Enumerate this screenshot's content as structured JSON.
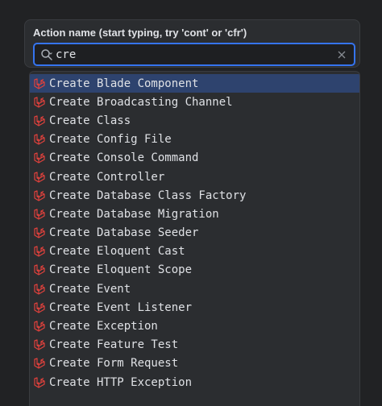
{
  "dialog": {
    "label": "Action name (start typing, try 'cont' or 'cfr')",
    "search_value": "cre"
  },
  "colors": {
    "accent": "#3574f0",
    "selection": "#2e436e",
    "laravel_icon": "#e0413c"
  },
  "icons": {
    "search": "search-icon",
    "clear": "close-icon",
    "item": "laravel-icon"
  },
  "items": [
    {
      "label": "Create Blade Component",
      "selected": true
    },
    {
      "label": "Create Broadcasting Channel"
    },
    {
      "label": "Create Class"
    },
    {
      "label": "Create Config File"
    },
    {
      "label": "Create Console Command"
    },
    {
      "label": "Create Controller"
    },
    {
      "label": "Create Database Class Factory"
    },
    {
      "label": "Create Database Migration"
    },
    {
      "label": "Create Database Seeder"
    },
    {
      "label": "Create Eloquent Cast"
    },
    {
      "label": "Create Eloquent Scope"
    },
    {
      "label": "Create Event"
    },
    {
      "label": "Create Event Listener"
    },
    {
      "label": "Create Exception"
    },
    {
      "label": "Create Feature Test"
    },
    {
      "label": "Create Form Request"
    },
    {
      "label": "Create HTTP Exception"
    }
  ]
}
